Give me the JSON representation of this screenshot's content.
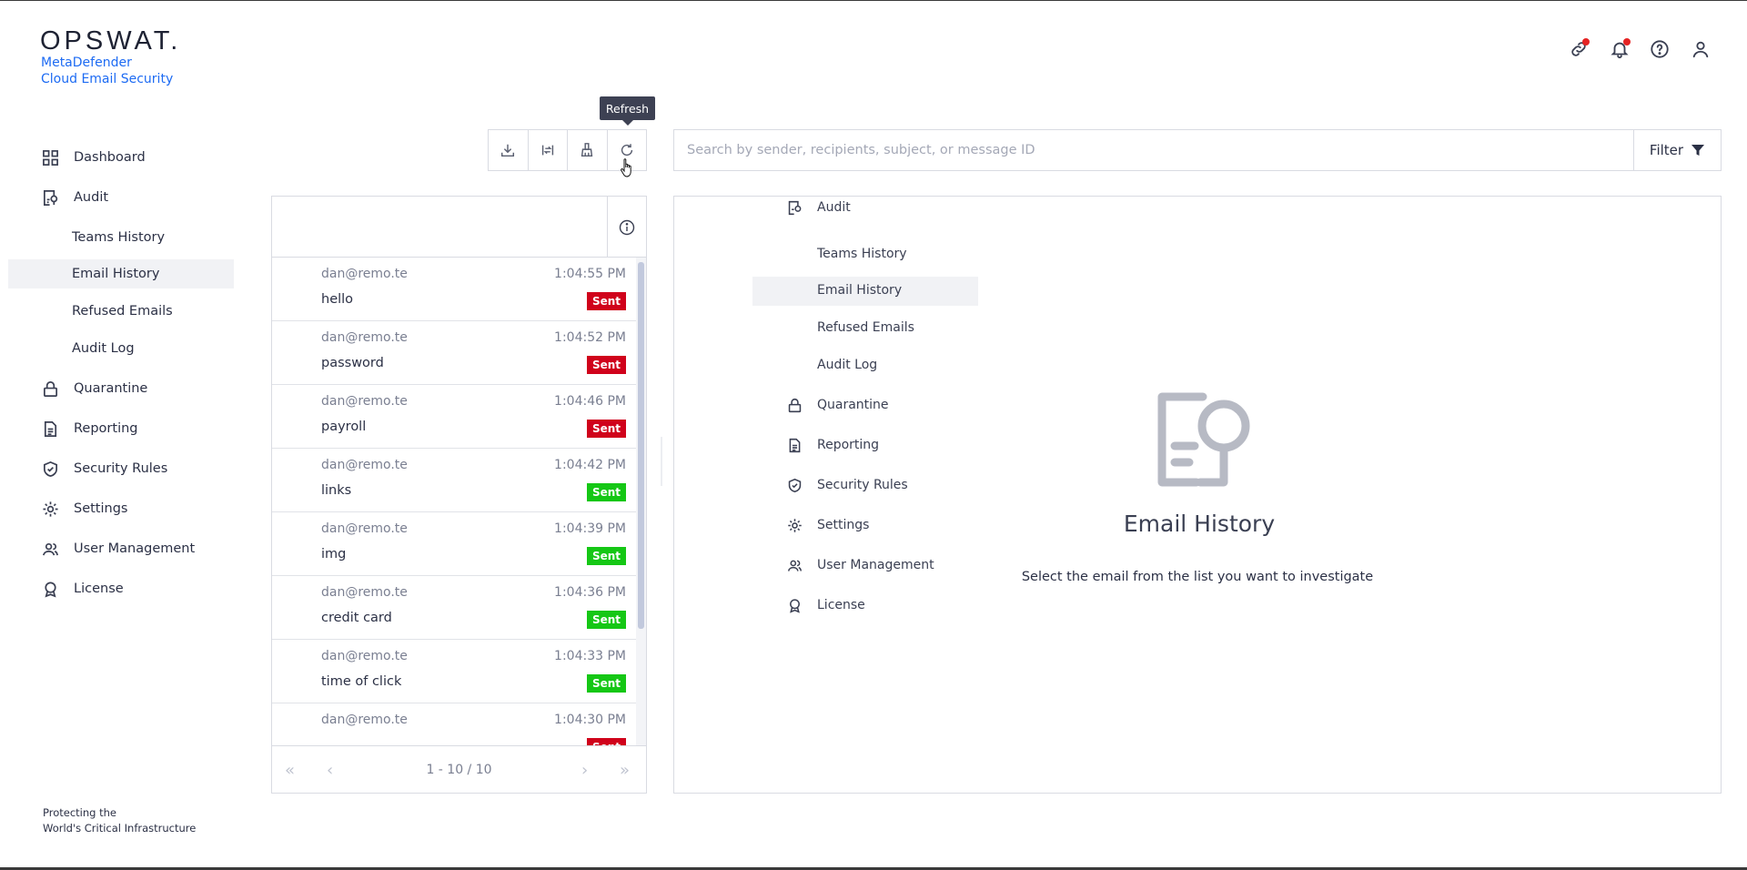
{
  "brand": {
    "logo": "OPSWAT.",
    "product_line1": "MetaDefender",
    "product_line2": "Cloud Email Security"
  },
  "header_icons": [
    "link-icon",
    "bell-icon",
    "help-icon",
    "user-icon"
  ],
  "sidebar": {
    "items": [
      {
        "label": "Dashboard",
        "icon": "dashboard-icon"
      },
      {
        "label": "Audit",
        "icon": "audit-icon"
      },
      {
        "label": "Teams History",
        "sub": true
      },
      {
        "label": "Email History",
        "sub": true,
        "active": true
      },
      {
        "label": "Refused Emails",
        "sub": true
      },
      {
        "label": "Audit Log",
        "sub": true
      },
      {
        "label": "Quarantine",
        "icon": "lock-icon"
      },
      {
        "label": "Reporting",
        "icon": "report-icon"
      },
      {
        "label": "Security Rules",
        "icon": "shield-check-icon"
      },
      {
        "label": "Settings",
        "icon": "gear-icon"
      },
      {
        "label": "User Management",
        "icon": "users-icon"
      },
      {
        "label": "License",
        "icon": "award-icon"
      }
    ],
    "footer_line1": "Protecting the",
    "footer_line2": "World's Critical Infrastructure"
  },
  "toolbar": {
    "buttons": [
      "download-icon",
      "sync-icon",
      "cleanup-icon",
      "refresh-icon"
    ],
    "tooltip": "Refresh"
  },
  "search": {
    "placeholder": "Search by sender, recipients, subject, or message ID",
    "filter_label": "Filter"
  },
  "emails": [
    {
      "from": "dan@remo.te",
      "time": "1:04:55 PM",
      "subject": "hello",
      "status": "Sent",
      "status_color": "#d0021b"
    },
    {
      "from": "dan@remo.te",
      "time": "1:04:52 PM",
      "subject": "password",
      "status": "Sent",
      "status_color": "#d0021b"
    },
    {
      "from": "dan@remo.te",
      "time": "1:04:46 PM",
      "subject": "payroll",
      "status": "Sent",
      "status_color": "#d0021b"
    },
    {
      "from": "dan@remo.te",
      "time": "1:04:42 PM",
      "subject": "links",
      "status": "Sent",
      "status_color": "#15c715"
    },
    {
      "from": "dan@remo.te",
      "time": "1:04:39 PM",
      "subject": "img",
      "status": "Sent",
      "status_color": "#15c715"
    },
    {
      "from": "dan@remo.te",
      "time": "1:04:36 PM",
      "subject": "credit card",
      "status": "Sent",
      "status_color": "#15c715"
    },
    {
      "from": "dan@remo.te",
      "time": "1:04:33 PM",
      "subject": "time of click",
      "status": "Sent",
      "status_color": "#15c715"
    },
    {
      "from": "dan@remo.te",
      "time": "1:04:30 PM",
      "subject": "",
      "status": "Sent",
      "status_color": "#d0021b"
    }
  ],
  "pager": {
    "text": "1 - 10 / 10"
  },
  "detail": {
    "ghost_nav": {
      "audit_label": "Audit",
      "sub_items": [
        "Teams History",
        "Email History",
        "Refused Emails",
        "Audit Log"
      ],
      "items": [
        "Quarantine",
        "Reporting",
        "Security Rules",
        "Settings",
        "User Management",
        "License"
      ]
    },
    "empty_title": "Email History",
    "empty_desc": "Select the email from the list you want to investigate"
  }
}
